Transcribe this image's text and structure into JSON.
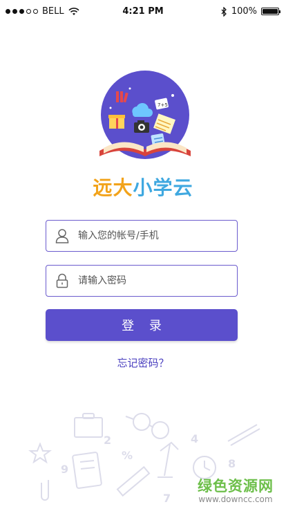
{
  "status_bar": {
    "carrier": "BELL",
    "time": "4:21 PM",
    "battery_text": "100%",
    "battery_level": 1.0,
    "signal_bars_filled": 3,
    "signal_bars_total": 5
  },
  "brand": {
    "name_chars": [
      "远",
      "大",
      "小",
      "学",
      "云"
    ],
    "colors": [
      "#f2a31b",
      "#f2a31b",
      "#3fa8e0",
      "#3fa8e0",
      "#3fa8e0"
    ],
    "accent": "#5b4fcc",
    "logo_circle_color": "#5b4fcc"
  },
  "login_form": {
    "account_placeholder": "输入您的帐号/手机",
    "account_value": "",
    "account_icon": "user-icon",
    "password_placeholder": "请输入密码",
    "password_value": "",
    "password_icon": "lock-icon",
    "login_label": "登 录",
    "forgot_label": "忘记密码？"
  },
  "watermark": {
    "site_cn": "绿色资源网",
    "site_url": "www.downcc.com"
  }
}
